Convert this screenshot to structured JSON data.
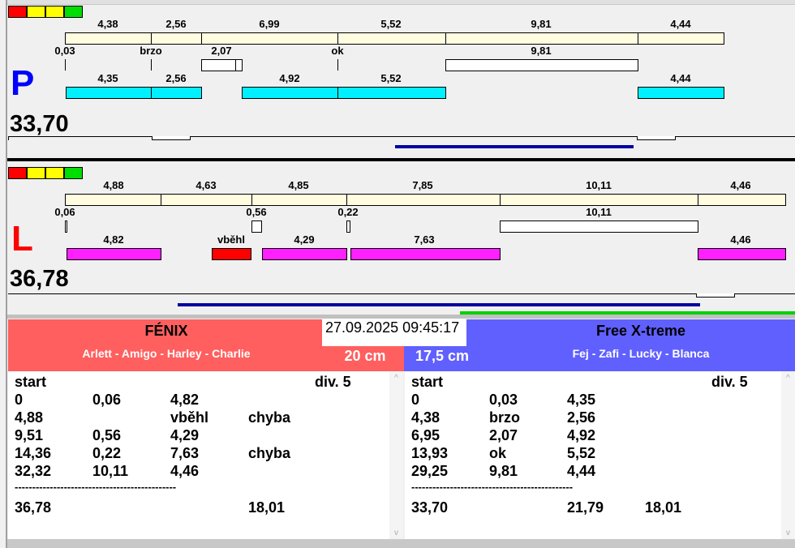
{
  "top": {
    "letter": "P",
    "total": "33,70",
    "row1": [
      "4,38",
      "2,56",
      "6,99",
      "5,52",
      "9,81",
      "4,44"
    ],
    "row2": [
      "0,03",
      "brzo",
      "2,07",
      "ok",
      "9,81"
    ],
    "row3": [
      "4,35",
      "2,56",
      "4,92",
      "5,52",
      "4,44"
    ]
  },
  "bottom": {
    "letter": "L",
    "total": "36,78",
    "row1": [
      "4,88",
      "4,63",
      "4,85",
      "7,85",
      "10,11",
      "4,46"
    ],
    "row2": [
      "0,06",
      "0,56",
      "0,22",
      "10,11"
    ],
    "row3": [
      "4,82",
      "vběhl",
      "4,29",
      "7,63",
      "4,46"
    ]
  },
  "datetime": "27.09.2025 09:45:17",
  "left_team": {
    "name": "FÉNIX",
    "dogs": "Arlett - Amigo - Harley - Charlie",
    "height": "20 cm",
    "header": [
      "start",
      "div.  5"
    ],
    "rows": [
      [
        "0",
        "0,06",
        "4,82",
        ""
      ],
      [
        "4,88",
        "",
        "vběhl",
        "chyba"
      ],
      [
        "9,51",
        "0,56",
        "4,29",
        ""
      ],
      [
        "14,36",
        "0,22",
        "7,63",
        "chyba"
      ],
      [
        "32,32",
        "10,11",
        "4,46",
        ""
      ]
    ],
    "divider": "----------------------------------------------",
    "totals": [
      "36,78",
      "",
      "",
      "18,01"
    ]
  },
  "right_team": {
    "name": "Free X-treme",
    "dogs": "Fej - Zafi - Lucky - Blanca",
    "height": "17,5 cm",
    "header": [
      "start",
      "div.  5"
    ],
    "rows": [
      [
        "0",
        "0,03",
        "4,35",
        ""
      ],
      [
        "4,38",
        "brzo",
        "2,56",
        ""
      ],
      [
        "6,95",
        "2,07",
        "4,92",
        ""
      ],
      [
        "13,93",
        "ok",
        "5,52",
        ""
      ],
      [
        "29,25",
        "9,81",
        "4,44",
        ""
      ]
    ],
    "divider": "----------------------------------------------",
    "totals": [
      "33,70",
      "",
      "21,79",
      "18,01"
    ]
  },
  "colors": {
    "top_letter": "#0000ff",
    "bottom_letter": "#ff0000",
    "left_header": "#ff5f5f",
    "right_header": "#6060ff"
  }
}
